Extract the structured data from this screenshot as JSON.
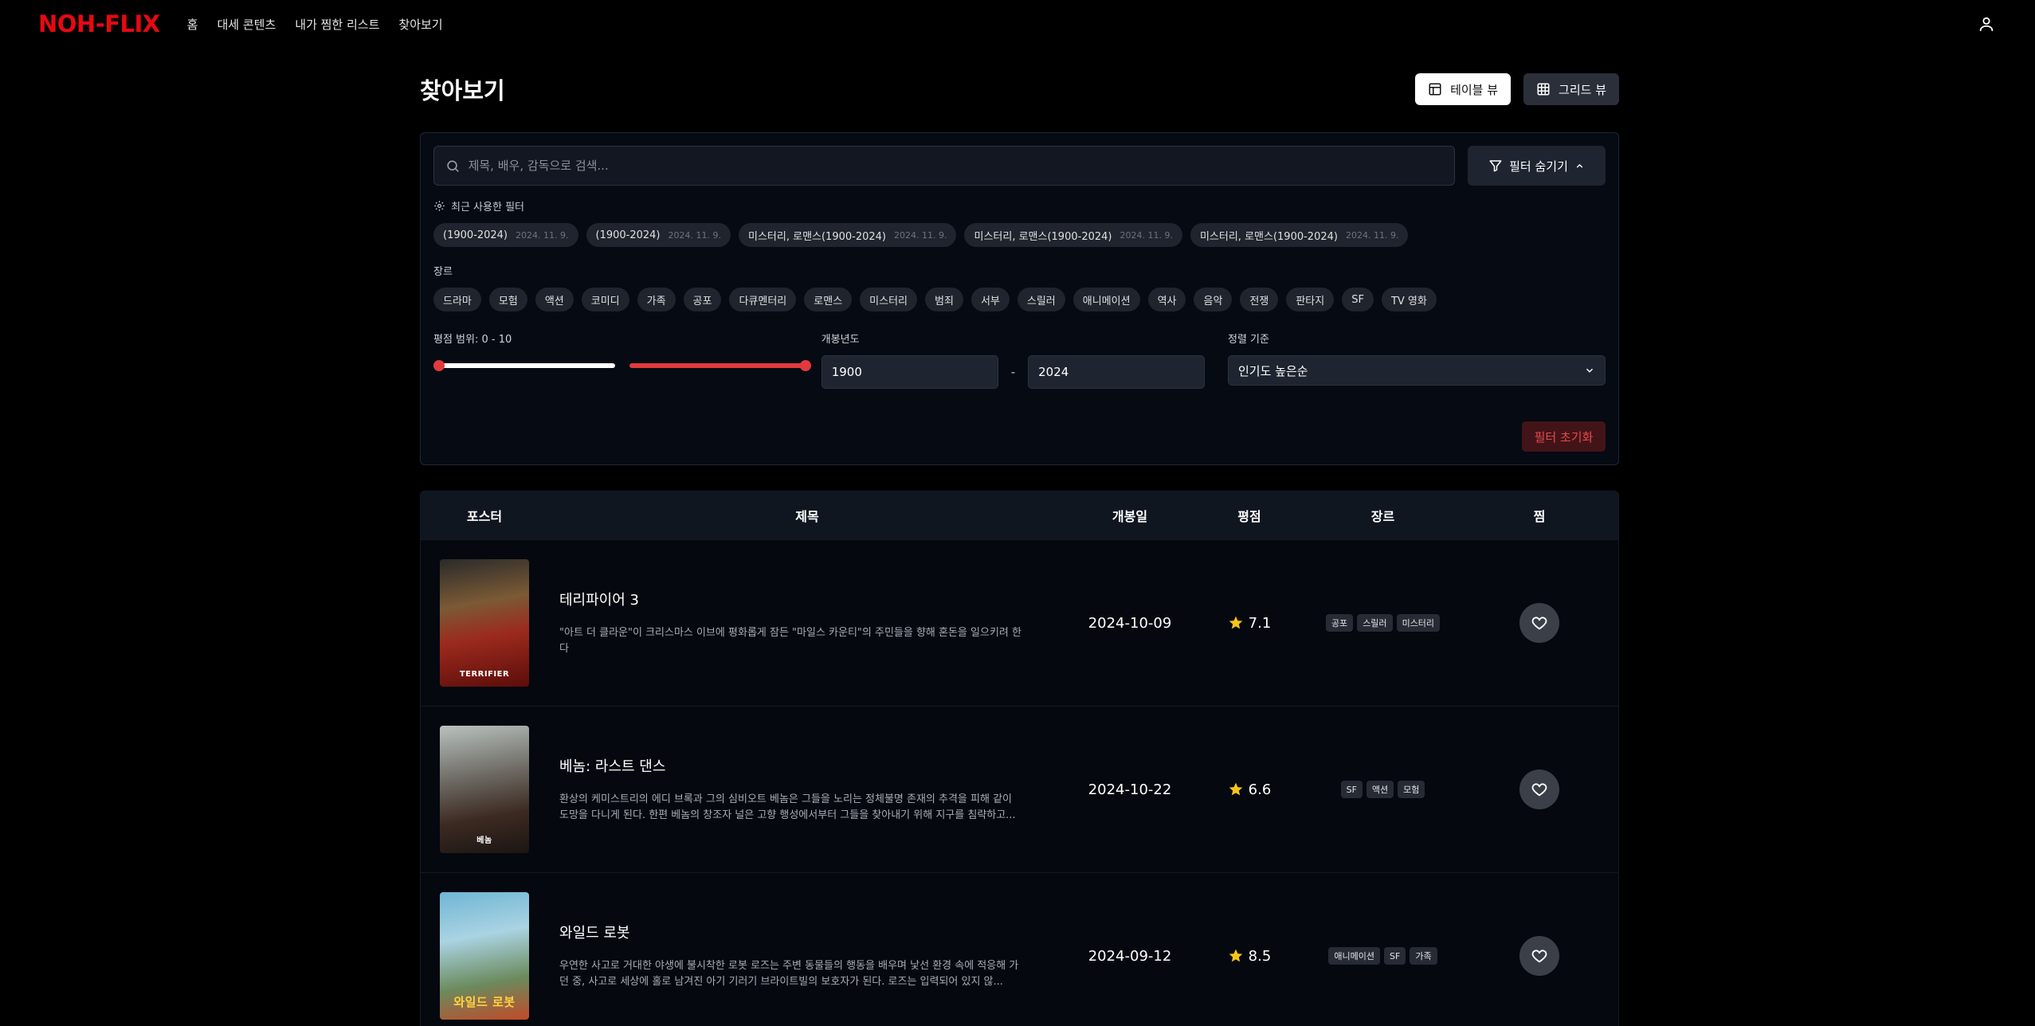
{
  "nav": {
    "logo": "NOH-FLIX",
    "links": [
      "홈",
      "대세 콘텐츠",
      "내가 찜한 리스트",
      "찾아보기"
    ],
    "user_icon": "user-icon"
  },
  "page": {
    "title": "찾아보기",
    "table_view_label": "테이블 뷰",
    "grid_view_label": "그리드 뷰"
  },
  "filters": {
    "search_placeholder": "제목, 배우, 감독으로 검색...",
    "toggle_label": "필터 숨기기",
    "recent_label": "최근 사용한 필터",
    "recent": [
      {
        "label": "(1900-2024)",
        "date": "2024. 11. 9."
      },
      {
        "label": "(1900-2024)",
        "date": "2024. 11. 9."
      },
      {
        "label": "미스터리, 로맨스(1900-2024)",
        "date": "2024. 11. 9."
      },
      {
        "label": "미스터리, 로맨스(1900-2024)",
        "date": "2024. 11. 9."
      },
      {
        "label": "미스터리, 로맨스(1900-2024)",
        "date": "2024. 11. 9."
      }
    ],
    "genre_label": "장르",
    "genres": [
      "드라마",
      "모험",
      "액션",
      "코미디",
      "가족",
      "공포",
      "다큐멘터리",
      "로맨스",
      "미스터리",
      "범죄",
      "서부",
      "스릴러",
      "애니메이션",
      "역사",
      "음악",
      "전쟁",
      "판타지",
      "SF",
      "TV 영화"
    ],
    "rating_label": "평점 범위: 0 - 10",
    "rating_min": 0,
    "rating_max": 10,
    "year_label": "개봉년도",
    "year_from": "1900",
    "year_sep": "-",
    "year_to": "2024",
    "sort_label": "정렬 기준",
    "sort_value": "인기도 높은순",
    "reset_label": "필터 초기화",
    "accent": "#e03a3e"
  },
  "table": {
    "headers": {
      "poster": "포스터",
      "title": "제목",
      "date": "개봉일",
      "rating": "평점",
      "genre": "장르",
      "fav": "찜"
    },
    "rows": [
      {
        "poster_text": "TERRIFIER",
        "title": "테리파이어 3",
        "desc": "\"아트 더 클라운\"이 크리스마스 이브에 평화롭게 잠든 \"마일스 카운티\"의 주민들을 향해 혼돈을 일으키려 한다",
        "date": "2024-10-09",
        "rating": "7.1",
        "genres": [
          "공포",
          "스릴러",
          "미스터리"
        ]
      },
      {
        "poster_text": "베놈",
        "title": "베놈: 라스트 댄스",
        "desc": "환상의 케미스트리의 에디 브록과 그의 심비오트 베놈은 그들을 노리는 정체불명 존재의 추격을 피해 같이 도망을 다니게 된다. 한편 베놈의 창조자 널은 고향 행성에서부터 그들을 찾아내기 위해 지구를 침략하고...",
        "date": "2024-10-22",
        "rating": "6.6",
        "genres": [
          "SF",
          "액션",
          "모험"
        ]
      },
      {
        "poster_text": "와일드 로봇",
        "title": "와일드 로봇",
        "desc": "우연한 사고로 거대한 야생에 불시착한 로봇 로즈는 주변 동물들의 행동을 배우며 낯선 환경 속에 적응해 가던 중, 사고로 세상에 홀로 남겨진 아기 기러기 브라이트빌의 보호자가 된다. 로즈는 입력되어 있지 않...",
        "date": "2024-09-12",
        "rating": "8.5",
        "genres": [
          "애니메이션",
          "SF",
          "가족"
        ]
      }
    ]
  }
}
